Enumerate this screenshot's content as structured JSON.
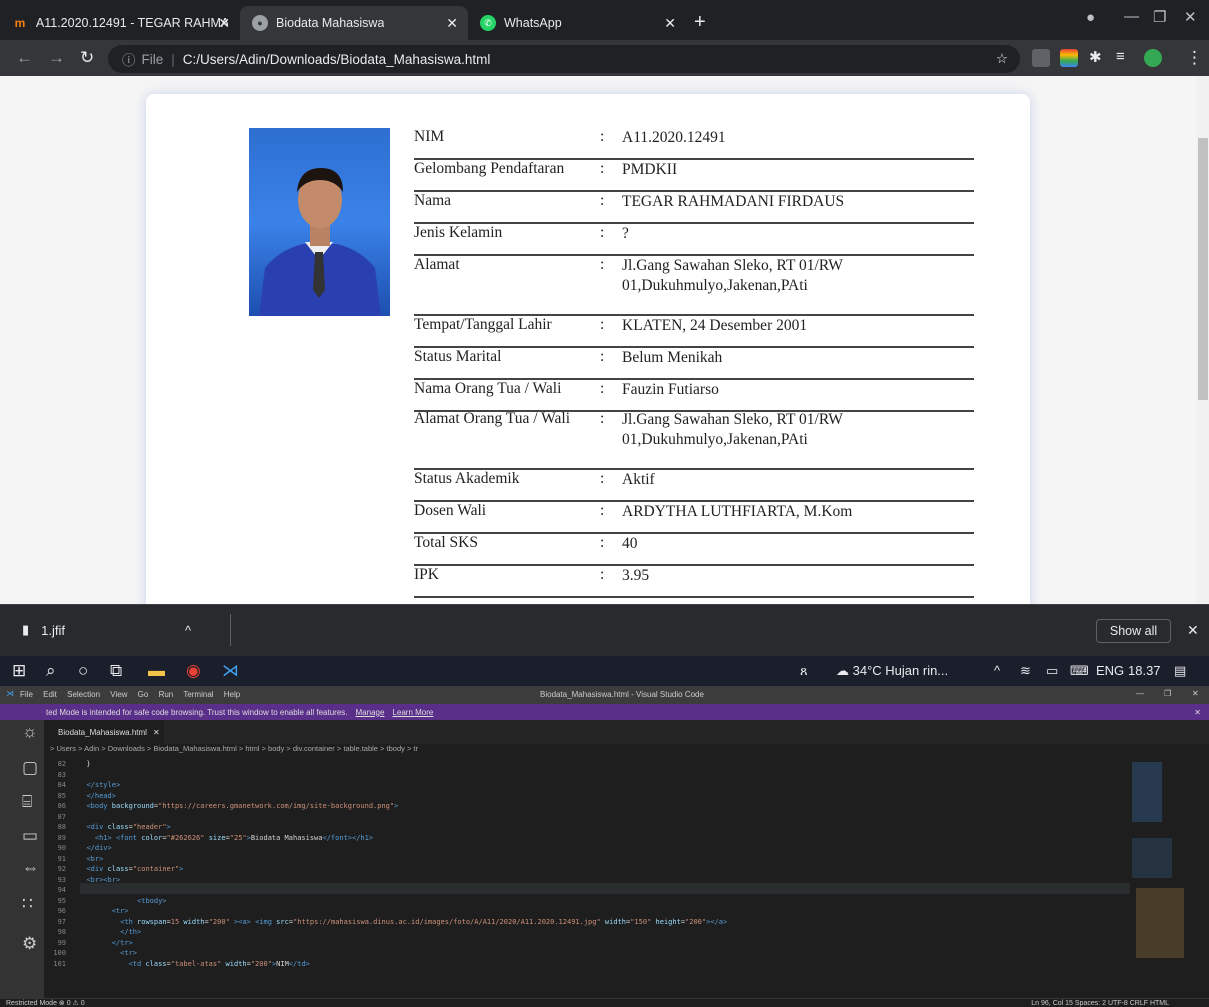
{
  "browser": {
    "tabs": [
      {
        "label": "A11.2020.12491 - TEGAR RAHMA",
        "icon": "moodle-m-icon",
        "active": false
      },
      {
        "label": "Biodata Mahasiswa",
        "icon": "globe-icon",
        "active": true
      },
      {
        "label": "WhatsApp",
        "icon": "whatsapp-icon",
        "active": false
      }
    ],
    "new_tab": "+",
    "address": {
      "prefix": "File",
      "url": "C:/Users/Adin/Downloads/Biodata_Mahasiswa.html"
    }
  },
  "biodata": {
    "rows": [
      {
        "label": "NIM",
        "value": "A11.2020.12491"
      },
      {
        "label": "Gelombang Pendaftaran",
        "value": "PMDKII"
      },
      {
        "label": "Nama",
        "value": "TEGAR RAHMADANI FIRDAUS"
      },
      {
        "label": "Jenis Kelamin",
        "value": "?"
      },
      {
        "label": "Alamat",
        "value": "Jl.Gang Sawahan Sleko, RT 01/RW 01,Dukuhmulyo,Jakenan,PAti"
      },
      {
        "label": "Tempat/Tanggal Lahir",
        "value": "KLATEN, 24 Desember 2001"
      },
      {
        "label": "Status Marital",
        "value": "Belum Menikah"
      },
      {
        "label": "Nama Orang Tua / Wali",
        "value": "Fauzin Futiarso"
      },
      {
        "label": "Alamat Orang Tua / Wali",
        "value": "Jl.Gang Sawahan Sleko, RT 01/RW 01,Dukuhmulyo,Jakenan,PAti"
      },
      {
        "label": "Status Akademik",
        "value": "Aktif"
      },
      {
        "label": "Dosen Wali",
        "value": "ARDYTHA LUTHFIARTA, M.Kom"
      },
      {
        "label": "Total SKS",
        "value": "40"
      },
      {
        "label": "IPK",
        "value": "3.95"
      }
    ],
    "separator": ":"
  },
  "downloads": {
    "file": "1.jfif",
    "show_all": "Show all"
  },
  "taskbar": {
    "weather": "34°C  Hujan rin...",
    "lang": "ENG",
    "time": "18.37"
  },
  "vscode": {
    "menu": [
      "File",
      "Edit",
      "Selection",
      "View",
      "Go",
      "Run",
      "Terminal",
      "Help"
    ],
    "title": "Biodata_Mahasiswa.html - Visual Studio Code",
    "banner": "ted Mode is intended for safe code browsing. Trust this window to enable all features.",
    "banner_manage": "Manage",
    "banner_learn": "Learn More",
    "tab": "Biodata_Mahasiswa.html",
    "breadcrumb": "> Users > Adin > Downloads > Biodata_Mahasiswa.html > html > body > div.container > table.table > tbody > tr",
    "status_left": "Restricted Mode   ⊗ 0 ⚠ 0",
    "status_right": "Ln 96, Col 15   Spaces: 2   UTF-8   CRLF   HTML"
  }
}
